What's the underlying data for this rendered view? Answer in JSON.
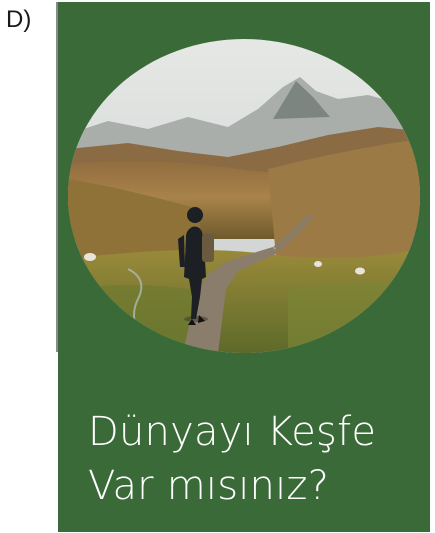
{
  "option": {
    "letter": "D)"
  },
  "poster": {
    "background_color": "#3b6a39",
    "headline_line1": "Dünyayı Keşfe",
    "headline_line2": "Var mısınız?",
    "photo_subject": "hiker-on-mountain-trail"
  }
}
